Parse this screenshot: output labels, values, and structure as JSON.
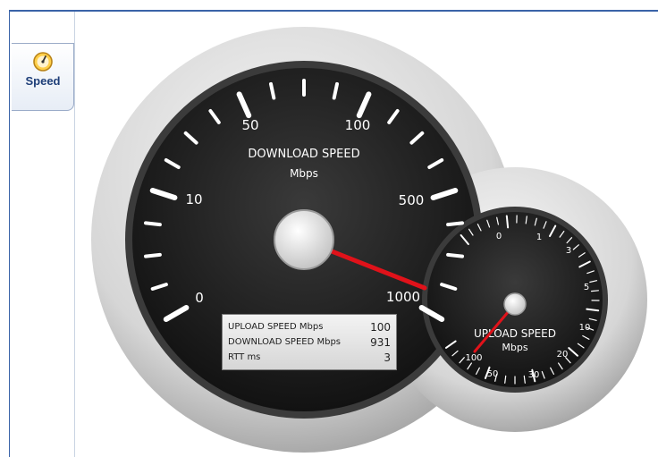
{
  "sidebar": {
    "tab_label": "Speed",
    "tab_icon": "speedometer-icon"
  },
  "download_gauge": {
    "title": "DOWNLOAD SPEED",
    "unit": "Mbps",
    "scale_labels": [
      "0",
      "10",
      "50",
      "100",
      "500",
      "1000"
    ],
    "needle_value": 931
  },
  "upload_gauge": {
    "title": "UPLOAD SPEED",
    "unit": "Mbps",
    "scale_labels": [
      "0",
      "1",
      "3",
      "5",
      "10",
      "20",
      "30",
      "50",
      "100"
    ],
    "needle_value": 100
  },
  "results": {
    "upload": {
      "label": "UPLOAD SPEED Mbps",
      "value": "100"
    },
    "download": {
      "label": "DOWNLOAD SPEED Mbps",
      "value": "931"
    },
    "rtt": {
      "label": "RTT ms",
      "value": "3"
    }
  },
  "colors": {
    "frame": "#3a63a8",
    "needle": "#e0121a",
    "dial_face": "#151515"
  }
}
